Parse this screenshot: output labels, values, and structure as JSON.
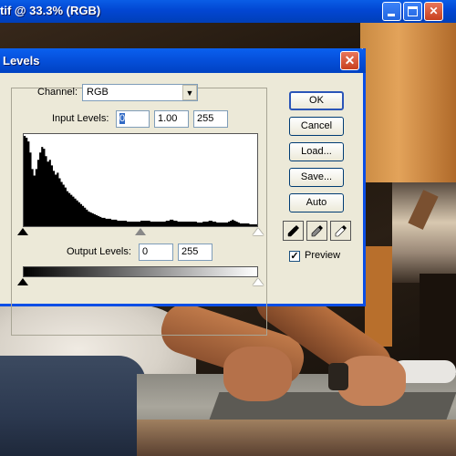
{
  "document": {
    "title": "tif @ 33.3% (RGB)",
    "minimize_glyph": "minimize-icon",
    "maximize_glyph": "maximize-icon",
    "close_glyph": "✕"
  },
  "dialog": {
    "title": "Levels",
    "close_glyph": "✕",
    "channel": {
      "label": "Channel:",
      "value": "RGB"
    },
    "input_levels": {
      "label": "Input Levels:",
      "black": "0",
      "mid": "1.00",
      "white": "255"
    },
    "output_levels": {
      "label": "Output Levels:",
      "black": "0",
      "white": "255"
    },
    "buttons": {
      "ok": "OK",
      "cancel": "Cancel",
      "load": "Load...",
      "save": "Save...",
      "auto": "Auto"
    },
    "eyedroppers": [
      "black-eyedropper-icon",
      "gray-eyedropper-icon",
      "white-eyedropper-icon"
    ],
    "preview": {
      "label": "Preview",
      "checked": true,
      "check_glyph": "✓"
    }
  },
  "histogram": {
    "levels": [
      98,
      96,
      92,
      80,
      62,
      55,
      62,
      72,
      80,
      86,
      84,
      76,
      70,
      72,
      66,
      60,
      56,
      58,
      52,
      48,
      45,
      42,
      38,
      36,
      34,
      32,
      30,
      28,
      26,
      24,
      22,
      20,
      18,
      16,
      15,
      14,
      13,
      12,
      11,
      10,
      9,
      9,
      8,
      8,
      8,
      7,
      7,
      7,
      6,
      6,
      6,
      6,
      6,
      5,
      5,
      5,
      5,
      5,
      5,
      5,
      6,
      6,
      6,
      6,
      6,
      5,
      5,
      5,
      5,
      5,
      5,
      5,
      5,
      6,
      6,
      7,
      7,
      6,
      6,
      5,
      5,
      5,
      5,
      5,
      5,
      5,
      5,
      5,
      5,
      4,
      4,
      4,
      5,
      5,
      5,
      6,
      6,
      5,
      5,
      4,
      4,
      4,
      4,
      4,
      4,
      5,
      6,
      7,
      6,
      5,
      4,
      3,
      3,
      3,
      3,
      3,
      2,
      2,
      2,
      2
    ]
  }
}
